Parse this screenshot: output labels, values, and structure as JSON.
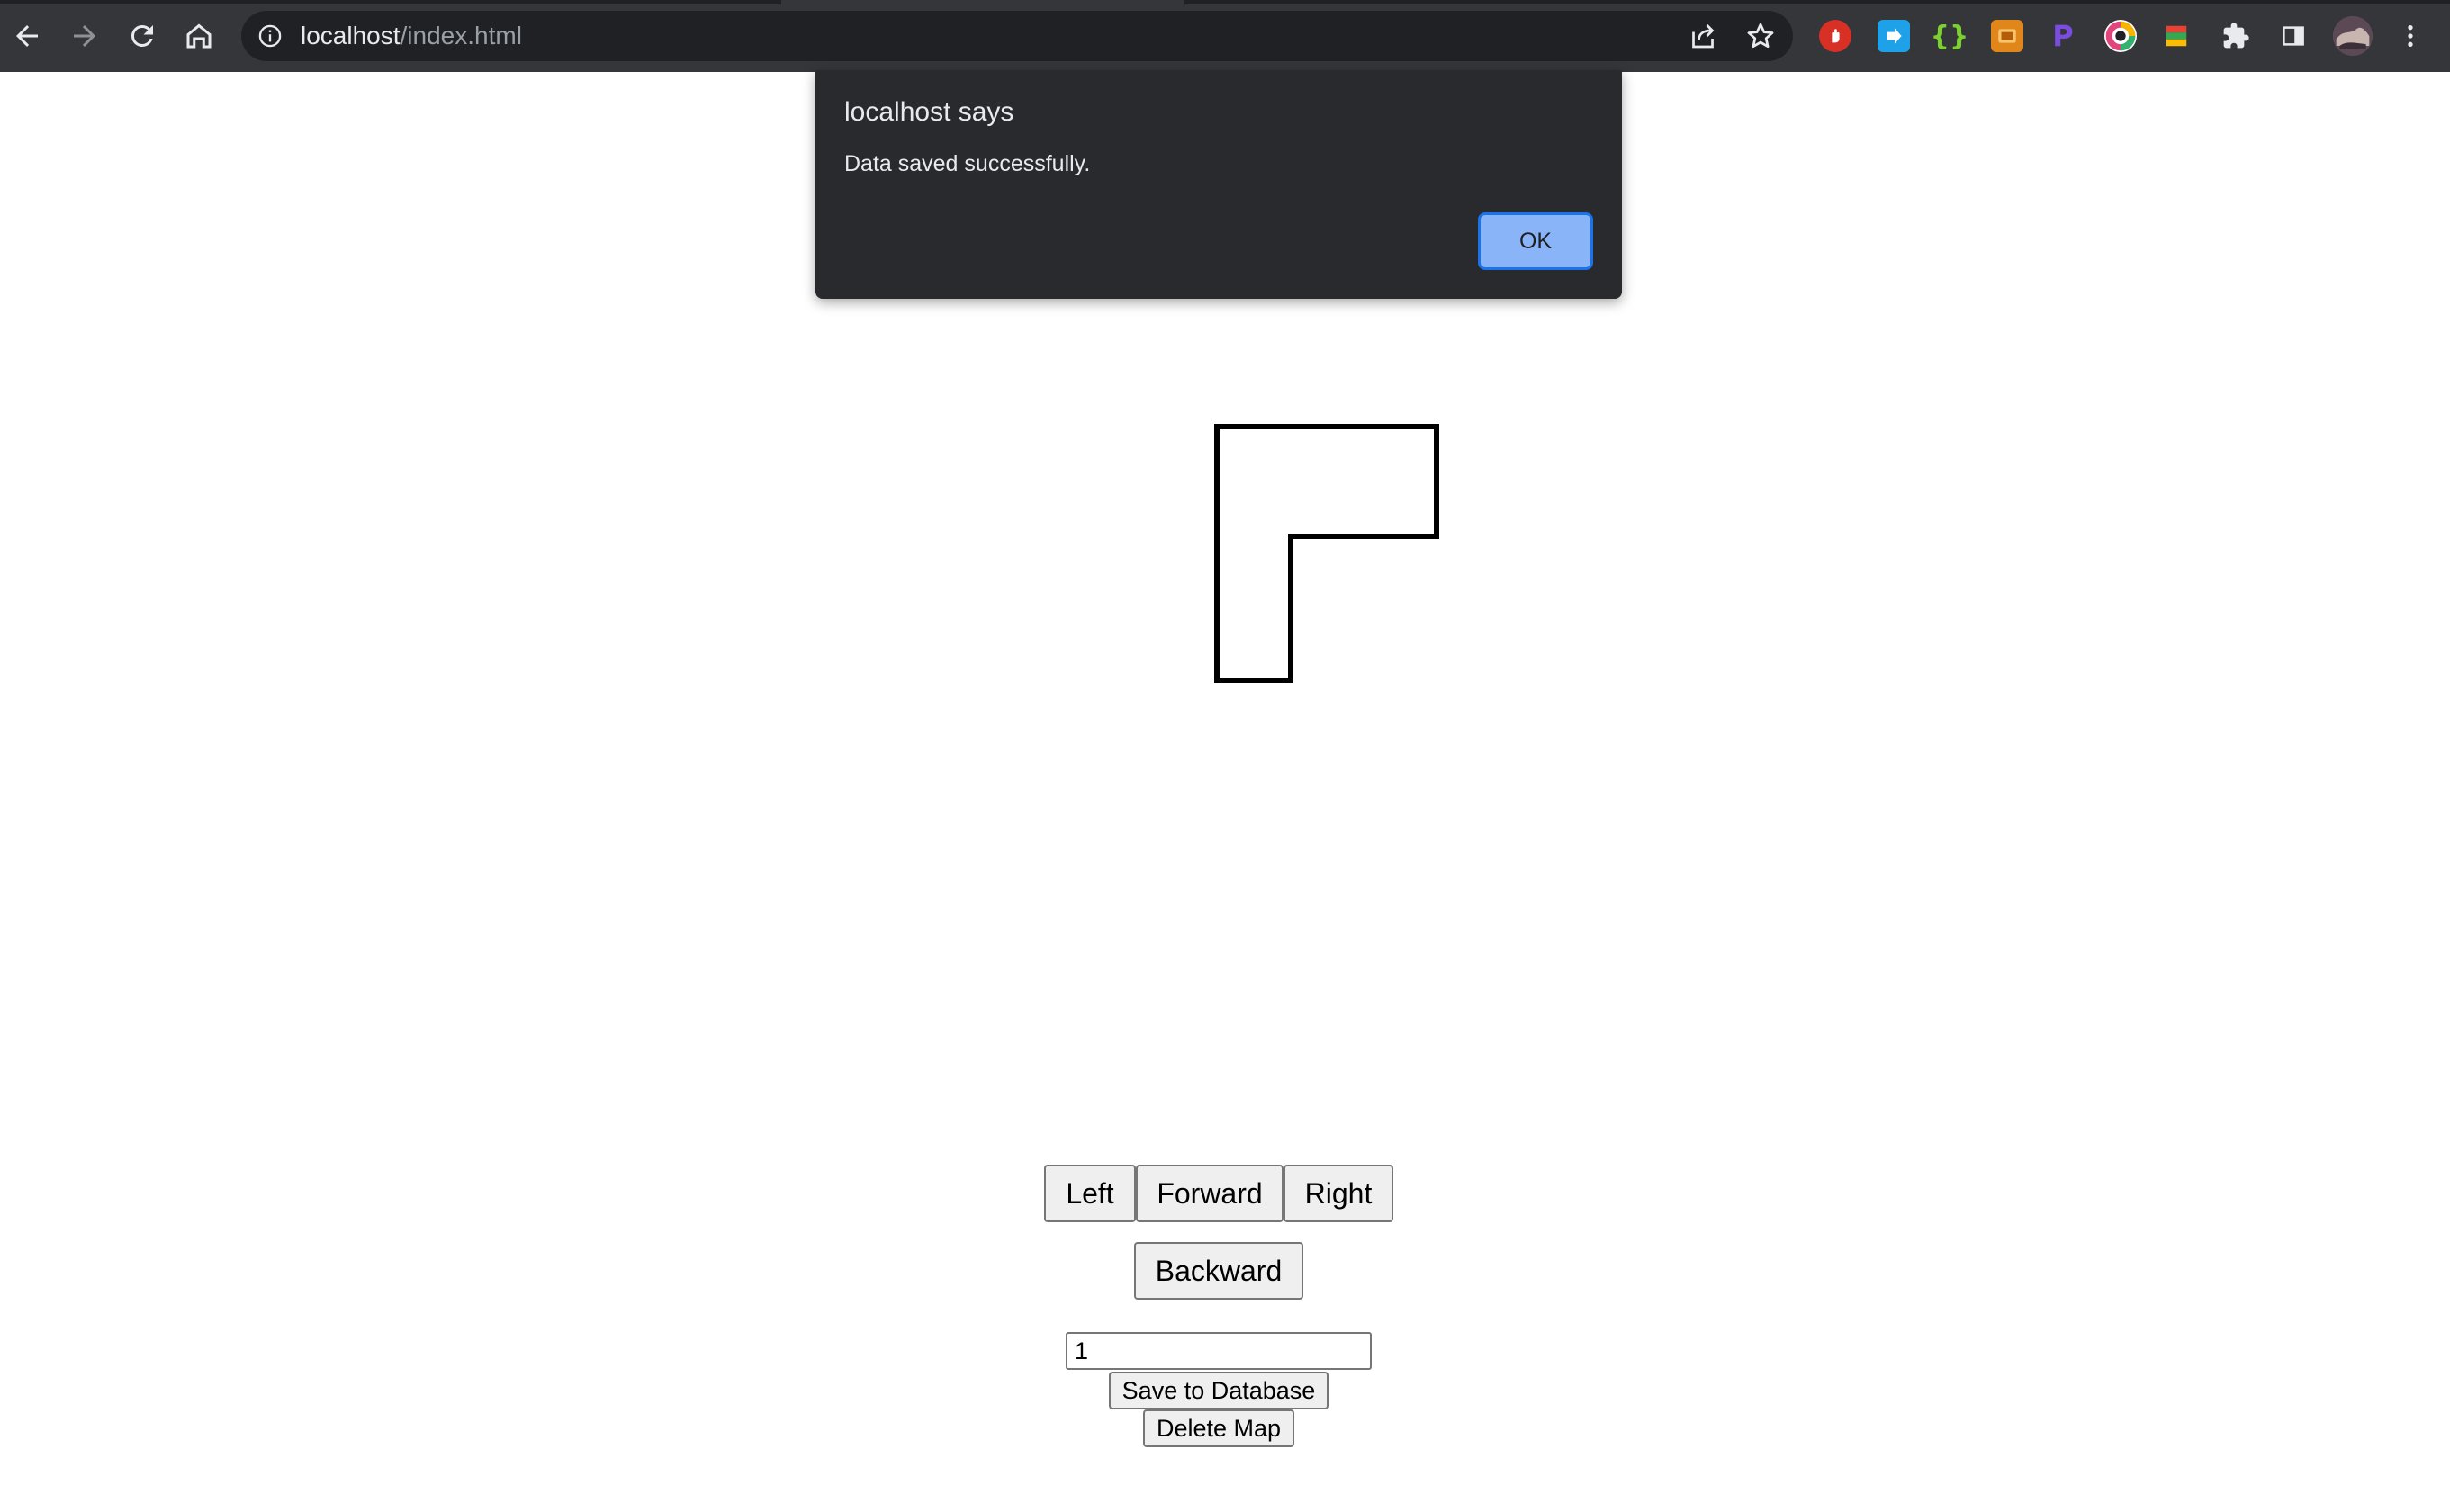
{
  "browser": {
    "url_host": "localhost",
    "url_path": "/index.html",
    "icons": {
      "back": "arrow-left-icon",
      "forward": "arrow-right-icon",
      "reload": "reload-icon",
      "home": "home-icon",
      "info": "info-icon",
      "share": "share-icon",
      "bookmark": "star-icon",
      "extensions": "puzzle-icon",
      "side_panel": "side-panel-icon",
      "menu": "kebab-menu-icon"
    },
    "colors": {
      "toolbar": "#35363a",
      "omnibox": "#202124",
      "text": "#e8eaed"
    }
  },
  "dialog": {
    "title": "localhost says",
    "message": "Data saved successfully.",
    "ok_label": "OK",
    "colors": {
      "background": "#292a2d",
      "button": "#8ab4f8"
    }
  },
  "controls": {
    "left_label": "Left",
    "forward_label": "Forward",
    "right_label": "Right",
    "backward_label": "Backward"
  },
  "map_form": {
    "map_id_value": "1",
    "save_label": "Save to Database",
    "delete_label": "Delete Map"
  }
}
